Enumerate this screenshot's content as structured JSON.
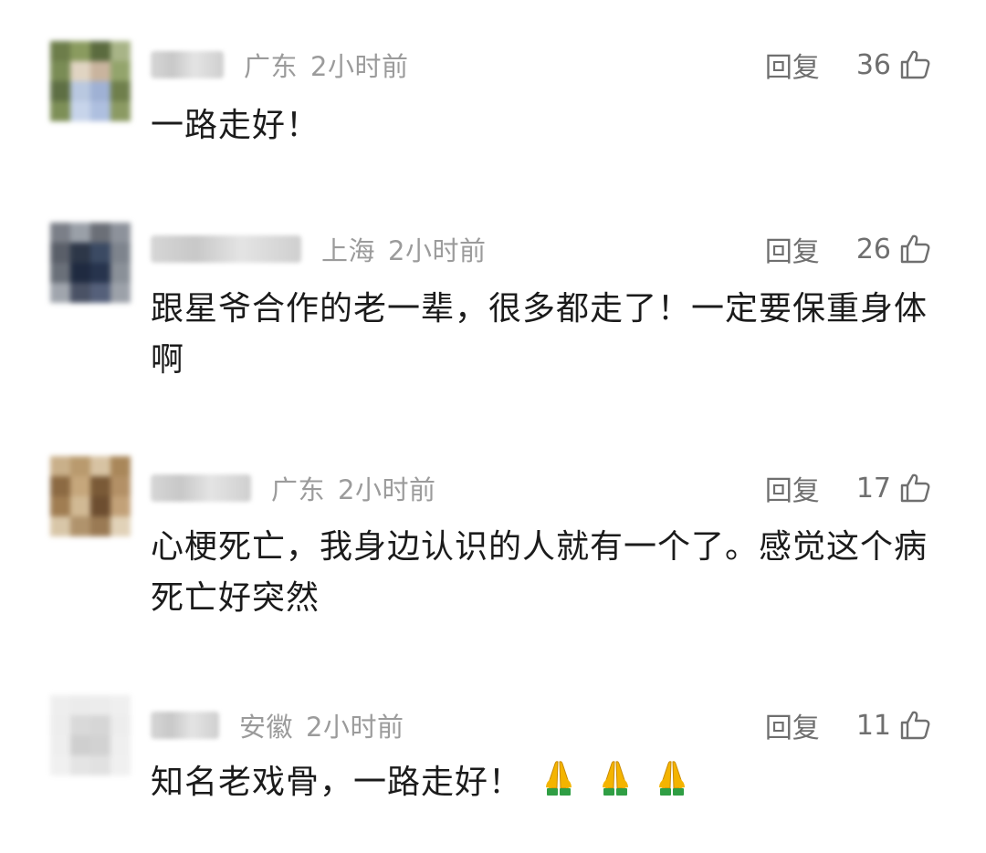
{
  "comments": [
    {
      "region": "广东",
      "time": "2小时前",
      "reply_label": "回复",
      "likes": "36",
      "text": "一路走好！",
      "username_blur_width": 80,
      "avatar_colors": [
        "#6d7d4a",
        "#8a9b5f",
        "#5b6b3f",
        "#a8b487",
        "#7a8c55",
        "#e0d4c2",
        "#c9b49e",
        "#93a46c",
        "#5e6f44",
        "#b9c8e0",
        "#9fb1d4",
        "#6f7f4c",
        "#7d8f57",
        "#c7d4ea",
        "#aebfdf",
        "#8b9a63"
      ]
    },
    {
      "region": "上海",
      "time": "2小时前",
      "reply_label": "回复",
      "likes": "26",
      "text": "跟星爷合作的老一辈，很多都走了！一定要保重身体啊",
      "username_blur_width": 165,
      "avatar_colors": [
        "#7b7f88",
        "#9aa0a8",
        "#6b6f77",
        "#8d929b",
        "#5a5f69",
        "#2d3748",
        "#3b4a63",
        "#7e848d",
        "#6a7079",
        "#1f2a40",
        "#27344d",
        "#8a9098",
        "#a0a5ad",
        "#4a5265",
        "#55607a",
        "#9ca1a9"
      ]
    },
    {
      "region": "广东",
      "time": "2小时前",
      "reply_label": "回复",
      "likes": "17",
      "text": "心梗死亡，我身边认识的人就有一个了。感觉这个病死亡好突然",
      "username_blur_width": 110,
      "avatar_colors": [
        "#c9b08a",
        "#b99a6e",
        "#d7c3a3",
        "#a9875a",
        "#8c6a43",
        "#c6a77c",
        "#7a5a37",
        "#b39066",
        "#a07d52",
        "#d1b994",
        "#6d4e30",
        "#c2a178",
        "#d8c6a8",
        "#b0936c",
        "#9a7a54",
        "#e1d2b8"
      ]
    },
    {
      "region": "安徽",
      "time": "2小时前",
      "reply_label": "回复",
      "likes": "11",
      "text": "知名老戏骨，一路走好！",
      "emoji_count": 3,
      "username_blur_width": 75,
      "avatar_colors": [
        "#eeeeee",
        "#ebebeb",
        "#ececec",
        "#efefef",
        "#ededed",
        "#d9d9d9",
        "#d6d6d6",
        "#ededed",
        "#eeeeee",
        "#cfcfcf",
        "#d2d2d2",
        "#efefef",
        "#f0f0f0",
        "#e4e4e4",
        "#e1e1e1",
        "#f0f0f0"
      ]
    }
  ],
  "colors": {
    "meta_text": "#9b9b9b",
    "action_text": "#6f6f6f",
    "body_text": "#1b1b1b",
    "emoji_skin": "#f4b400",
    "emoji_sleeve": "#2f9e44"
  },
  "icons": {
    "like": "thumbs-up-outline-icon",
    "emoji": "folded-hands-emoji"
  }
}
